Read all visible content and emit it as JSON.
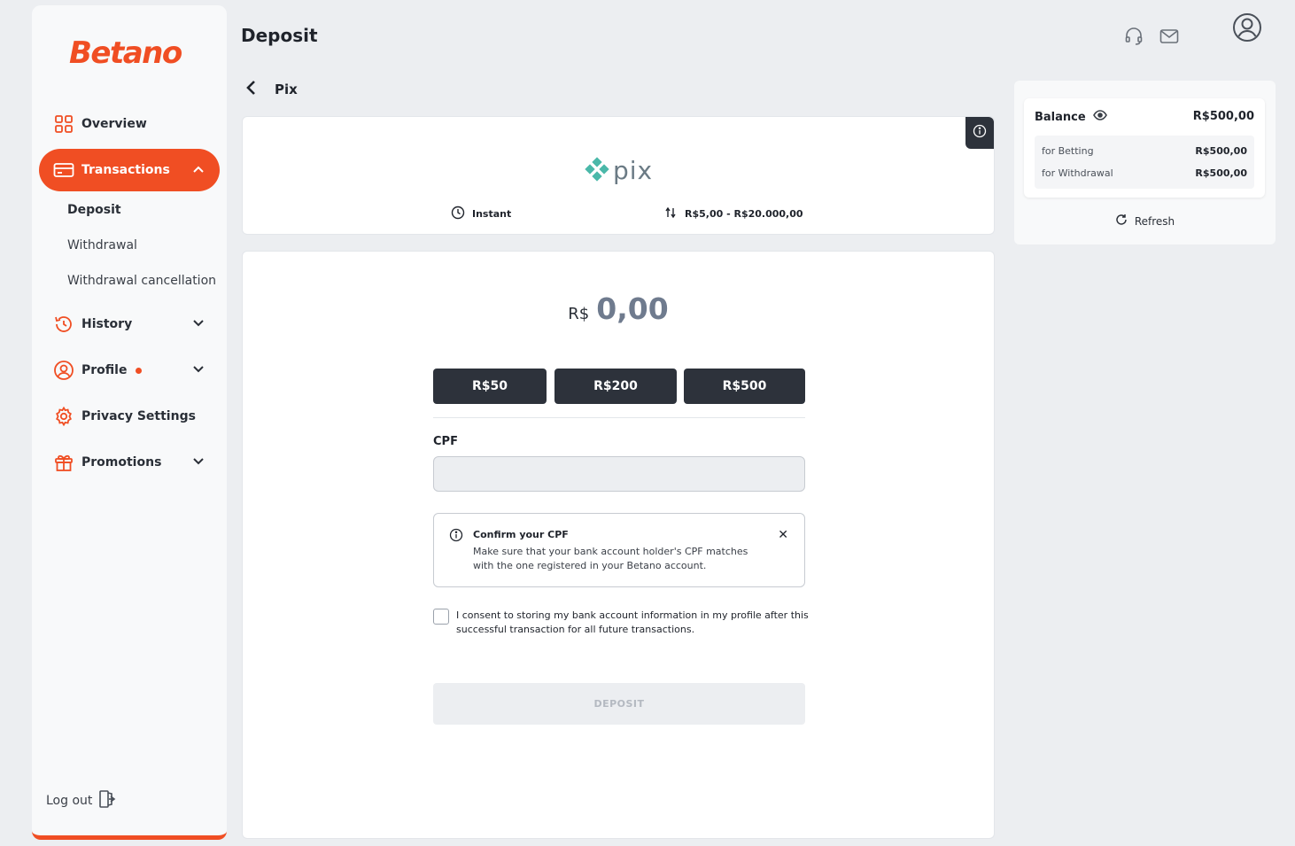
{
  "brand": {
    "logo_text": "Betano",
    "accent_color": "#f04e23"
  },
  "sidebar": {
    "items": [
      {
        "label": "Overview",
        "icon": "grid-icon"
      },
      {
        "label": "Transactions",
        "icon": "card-icon",
        "active": true,
        "expanded": true
      },
      {
        "label": "History",
        "icon": "history-icon"
      },
      {
        "label": "Profile",
        "icon": "user-circle-icon",
        "has_dot": true
      },
      {
        "label": "Privacy Settings",
        "icon": "gear-icon"
      },
      {
        "label": "Promotions",
        "icon": "gift-icon"
      }
    ],
    "sub_items": [
      "Deposit",
      "Withdrawal",
      "Withdrawal cancellation"
    ],
    "logout_label": "Log out"
  },
  "header": {
    "title": "Deposit"
  },
  "method": {
    "back_label": "Pix",
    "logo_text": "pix",
    "speed_label": "Instant",
    "limits_label": "R$5,00 - R$20.000,00"
  },
  "form": {
    "currency": "R$",
    "amount": "0,00",
    "quick_amounts": [
      "R$50",
      "R$200",
      "R$500"
    ],
    "cpf_label": "CPF",
    "cpf_value": "",
    "notice_title": "Confirm your CPF",
    "notice_body": "Make sure that your bank account holder's CPF matches with the one registered in your Betano account.",
    "consent_text": "I consent to storing my bank account information in my profile after this successful transaction for all future transactions.",
    "consent_checked": false,
    "submit_label": "DEPOSIT"
  },
  "balance": {
    "title": "Balance",
    "total": "R$500,00",
    "rows": [
      {
        "label": "for Betting",
        "value": "R$500,00"
      },
      {
        "label": "for Withdrawal",
        "value": "R$500,00"
      }
    ],
    "refresh_label": "Refresh"
  }
}
